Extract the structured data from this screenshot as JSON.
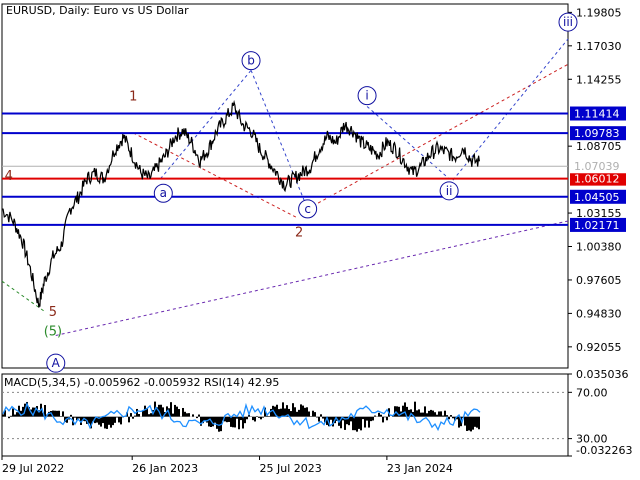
{
  "header": {
    "title": "EURUSD, Daily:  Euro vs US Dollar",
    "indicator": "MACD(5,34,5) -0.005962 -0.005932 RSI(14) 42.95"
  },
  "colors": {
    "price_line": "#000000",
    "support": "#0000cc",
    "red_level": "#e00000",
    "current_price": "#b0b0b0",
    "wave_label": "#1010a0",
    "wave_count": "#8b2a1a",
    "trend_red": "#cc2222",
    "trend_blue": "#3344cc",
    "trend_purple": "#6a2ab0",
    "trend_green": "#2a8a2a",
    "macd_hist": "#000000",
    "rsi_line": "#1e8fff"
  },
  "chart_data": {
    "type": "line",
    "symbol": "EURUSD",
    "timeframe": "Daily",
    "x_ticks": [
      "29 Jul 2022",
      "26 Jan 2023",
      "25 Jul 2023",
      "23 Jan 2024"
    ],
    "y_ticks": [
      "1.19805",
      "1.17030",
      "1.14255",
      "1.08705",
      "1.03155",
      "1.00380",
      "0.97605",
      "0.94830",
      "0.92055"
    ],
    "ylim": [
      0.903,
      1.205
    ],
    "horizontal_levels": [
      {
        "value": 1.11414,
        "label": "1.11414",
        "style": "support"
      },
      {
        "value": 1.09783,
        "label": "1.09783",
        "style": "support"
      },
      {
        "value": 1.06012,
        "label": "1.06012",
        "style": "red"
      },
      {
        "value": 1.04505,
        "label": "1.04505",
        "style": "support"
      },
      {
        "value": 1.02171,
        "label": "1.02171",
        "style": "support"
      },
      {
        "value": 1.07039,
        "label": "1.07039",
        "style": "current"
      }
    ],
    "price_path": [
      [
        0,
        1.035
      ],
      [
        0.02,
        1.025
      ],
      [
        0.035,
        1.01
      ],
      [
        0.05,
        0.985
      ],
      [
        0.065,
        0.955
      ],
      [
        0.075,
        0.975
      ],
      [
        0.09,
        0.995
      ],
      [
        0.105,
        1.005
      ],
      [
        0.12,
        1.035
      ],
      [
        0.135,
        1.045
      ],
      [
        0.15,
        1.06
      ],
      [
        0.165,
        1.065
      ],
      [
        0.18,
        1.06
      ],
      [
        0.2,
        1.085
      ],
      [
        0.215,
        1.095
      ],
      [
        0.23,
        1.08
      ],
      [
        0.245,
        1.065
      ],
      [
        0.26,
        1.06
      ],
      [
        0.275,
        1.07
      ],
      [
        0.29,
        1.08
      ],
      [
        0.305,
        1.095
      ],
      [
        0.32,
        1.1
      ],
      [
        0.335,
        1.09
      ],
      [
        0.35,
        1.075
      ],
      [
        0.365,
        1.085
      ],
      [
        0.38,
        1.1
      ],
      [
        0.395,
        1.11
      ],
      [
        0.41,
        1.12
      ],
      [
        0.425,
        1.105
      ],
      [
        0.44,
        1.1
      ],
      [
        0.455,
        1.085
      ],
      [
        0.47,
        1.075
      ],
      [
        0.485,
        1.065
      ],
      [
        0.5,
        1.055
      ],
      [
        0.515,
        1.06
      ],
      [
        0.53,
        1.065
      ],
      [
        0.545,
        1.07
      ],
      [
        0.56,
        1.085
      ],
      [
        0.575,
        1.095
      ],
      [
        0.59,
        1.09
      ],
      [
        0.605,
        1.105
      ],
      [
        0.62,
        1.1
      ],
      [
        0.635,
        1.09
      ],
      [
        0.65,
        1.085
      ],
      [
        0.665,
        1.08
      ],
      [
        0.68,
        1.09
      ],
      [
        0.695,
        1.085
      ],
      [
        0.71,
        1.075
      ],
      [
        0.725,
        1.065
      ],
      [
        0.74,
        1.07
      ],
      [
        0.755,
        1.08
      ],
      [
        0.77,
        1.085
      ],
      [
        0.785,
        1.082
      ],
      [
        0.8,
        1.078
      ],
      [
        0.815,
        1.086
      ],
      [
        0.83,
        1.075
      ],
      [
        0.845,
        1.074
      ]
    ],
    "wave_labels": [
      {
        "text": "a",
        "circled": true,
        "t": 0.285,
        "value": 1.048
      },
      {
        "text": "b",
        "circled": true,
        "t": 0.44,
        "value": 1.158
      },
      {
        "text": "c",
        "circled": true,
        "t": 0.54,
        "value": 1.035
      },
      {
        "text": "i",
        "circled": true,
        "t": 0.645,
        "value": 1.129
      },
      {
        "text": "ii",
        "circled": true,
        "t": 0.79,
        "value": 1.05
      },
      {
        "text": "iii",
        "circled": true,
        "t": 1.0,
        "value": 1.19
      },
      {
        "text": "A",
        "circled": true,
        "t": 0.095,
        "value": 0.907
      }
    ],
    "count_labels": [
      {
        "text": "1",
        "t": 0.232,
        "value": 1.125
      },
      {
        "text": "2",
        "t": 0.525,
        "value": 1.012
      },
      {
        "text": "4",
        "t": 0.012,
        "value": 1.059
      },
      {
        "text": "5",
        "t": 0.09,
        "value": 0.946
      }
    ],
    "green_label": {
      "text": "(5)",
      "t": 0.09,
      "value": 0.93
    },
    "macd_panel": {
      "y_ticks": [
        "0.035036",
        "70.00",
        "30.00",
        "-0.032263"
      ],
      "ylim": [
        -0.032263,
        0.035036
      ]
    }
  }
}
